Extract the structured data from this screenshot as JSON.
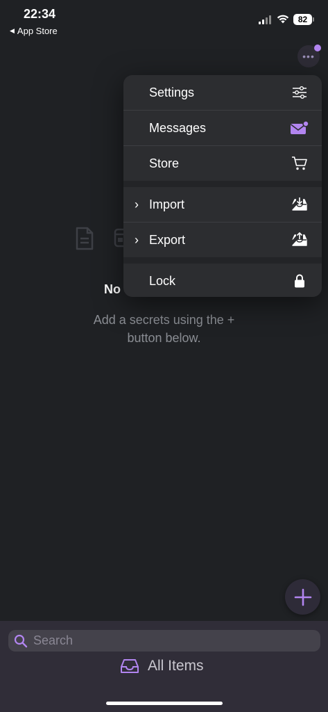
{
  "status_bar": {
    "time": "22:34",
    "back_app": "App Store",
    "battery": "82"
  },
  "empty_state": {
    "title": "No",
    "subtitle": "Add a secrets using the + button below."
  },
  "menu": {
    "items": [
      {
        "label": "Settings",
        "icon": "sliders-icon"
      },
      {
        "label": "Messages",
        "icon": "envelope-badge-icon"
      },
      {
        "label": "Store",
        "icon": "cart-icon"
      },
      {
        "label": "Import",
        "icon": "tray-download-icon",
        "submenu": true
      },
      {
        "label": "Export",
        "icon": "tray-upload-icon",
        "submenu": true
      },
      {
        "label": "Lock",
        "icon": "lock-icon"
      }
    ]
  },
  "search": {
    "placeholder": "Search"
  },
  "bottom": {
    "all_items_label": "All Items"
  },
  "colors": {
    "accent": "#b285f0",
    "background": "#1f2124",
    "menu_bg": "#2c2d30",
    "bottom_bar": "#302d38"
  }
}
